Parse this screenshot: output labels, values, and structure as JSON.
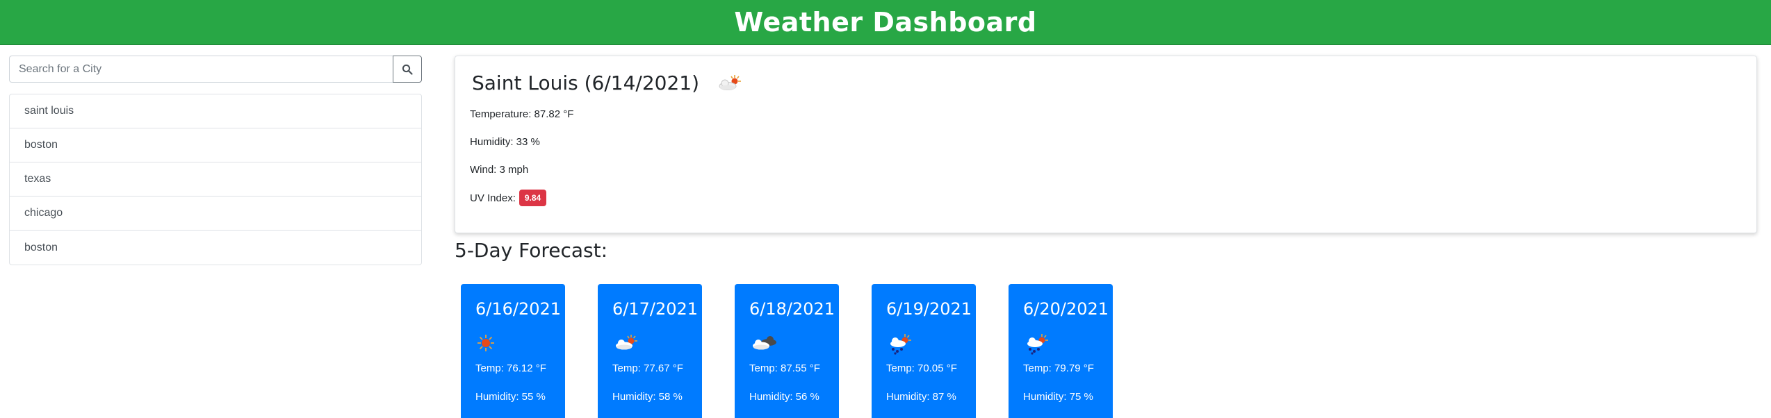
{
  "header": {
    "title": "Weather Dashboard"
  },
  "search": {
    "placeholder": "Search for a City",
    "value": "",
    "button_icon": "search-icon"
  },
  "history": [
    "saint louis",
    "boston",
    "texas",
    "chicago",
    "boston"
  ],
  "current": {
    "title": "Saint Louis (6/14/2021)",
    "icon": "partly-cloudy-sun-icon",
    "temperature": "Temperature: 87.82 °F",
    "humidity": "Humidity: 33 %",
    "wind": "Wind: 3 mph",
    "uv_label": "UV Index:",
    "uv_value": "9.84",
    "uv_color": "#dc3545"
  },
  "forecast_heading": "5-Day Forecast:",
  "forecast": [
    {
      "date": "6/16/2021",
      "icon": "sun-icon",
      "temp": "Temp: 76.12 °F",
      "humidity": "Humidity: 55 %"
    },
    {
      "date": "6/17/2021",
      "icon": "partly-cloudy-sun-icon",
      "temp": "Temp: 77.67 °F",
      "humidity": "Humidity: 58 %"
    },
    {
      "date": "6/18/2021",
      "icon": "broken-clouds-icon",
      "temp": "Temp: 87.55 °F",
      "humidity": "Humidity: 56 %"
    },
    {
      "date": "6/19/2021",
      "icon": "rain-sun-icon",
      "temp": "Temp: 70.05 °F",
      "humidity": "Humidity: 87 %"
    },
    {
      "date": "6/20/2021",
      "icon": "rain-sun-icon",
      "temp": "Temp: 79.79 °F",
      "humidity": "Humidity: 75 %"
    }
  ],
  "colors": {
    "header": "#28a745",
    "forecast_card": "#007bff",
    "uv_badge": "#dc3545"
  }
}
